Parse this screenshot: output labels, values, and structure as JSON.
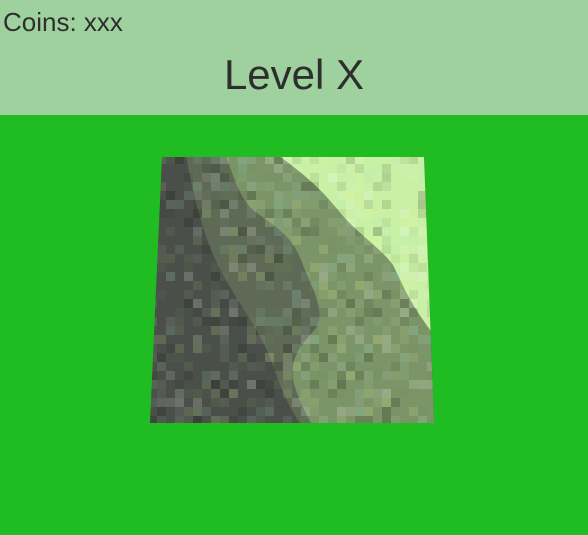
{
  "hud": {
    "coins_label": "Coins: xxx",
    "level_title": "Level X"
  },
  "colors": {
    "background": "#1fbd22",
    "hud_background": "#9fd19f",
    "text": "#2e2e2e",
    "terrain_dark": "#4a5049",
    "terrain_mid_dark": "#5e6a55",
    "terrain_mid": "#7c9568",
    "terrain_light": "#c9f0a5"
  }
}
